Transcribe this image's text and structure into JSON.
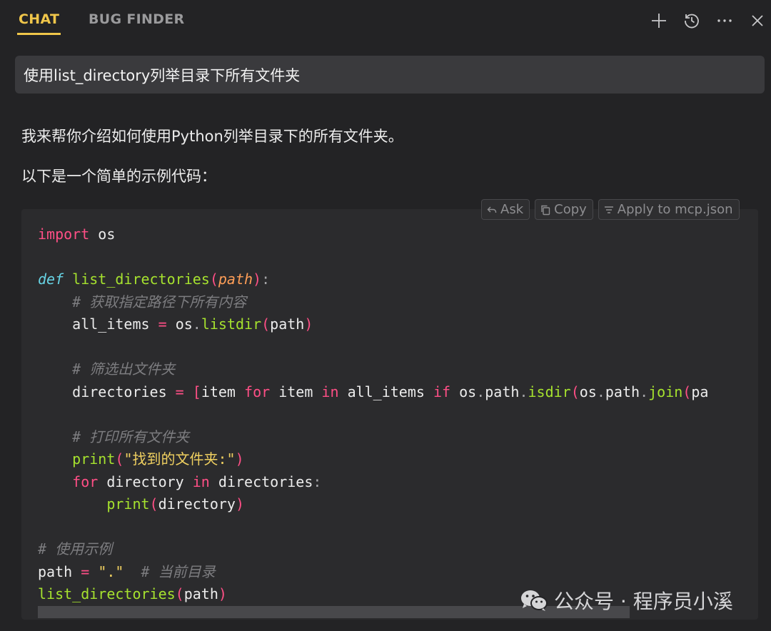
{
  "tabs": [
    {
      "label": "CHAT",
      "active": true
    },
    {
      "label": "BUG FINDER",
      "active": false
    }
  ],
  "toolbar_icons": [
    "plus-icon",
    "history-icon",
    "more-icon",
    "close-icon"
  ],
  "query": "使用list_directory列举目录下所有文件夹",
  "response": {
    "intro": "我来帮你介绍如何使用Python列举目录下的所有文件夹。",
    "lead": "以下是一个简单的示例代码："
  },
  "code_actions": {
    "ask": "Ask",
    "copy": "Copy",
    "apply": "Apply to mcp.json"
  },
  "code": {
    "l1_kw": "import",
    "l1_rest": " os",
    "l3_def": "def",
    "l3_fn": "list_directories",
    "l3_param": "path",
    "l4_comment": "# 获取指定路径下所有内容",
    "l5_var": "all_items",
    "l5_obj": "os",
    "l5_fn": "listdir",
    "l5_arg": "path",
    "l7_comment": "# 筛选出文件夹",
    "l8_var": "directories",
    "l8_item": "item",
    "l8_for": "for",
    "l8_in": "in",
    "l8_iter": "all_items",
    "l8_if": "if",
    "l8_os": "os",
    "l8_path": "path",
    "l8_isdir": "isdir",
    "l8_join": "join",
    "l8_pa": "pa",
    "l10_comment": "# 打印所有文件夹",
    "l11_fn": "print",
    "l11_str": "\"找到的文件夹:\"",
    "l12_for": "for",
    "l12_var": "directory",
    "l12_in": "in",
    "l12_iter": "directories",
    "l13_fn": "print",
    "l13_arg": "directory",
    "l15_comment": "# 使用示例",
    "l16_var": "path",
    "l16_str": "\".\"",
    "l16_comment": "# 当前目录",
    "l17_fn": "list_directories",
    "l17_arg": "path"
  },
  "watermark": "公众号 · 程序员小溪",
  "colors": {
    "background": "#232325",
    "accent_tab": "#f0c64a",
    "keyword": "#ff4f86",
    "function": "#a6e22e",
    "def_keyword": "#67d3e4",
    "parameter": "#ff9e57",
    "comment": "#7d7d80",
    "string": "#f0d060"
  }
}
